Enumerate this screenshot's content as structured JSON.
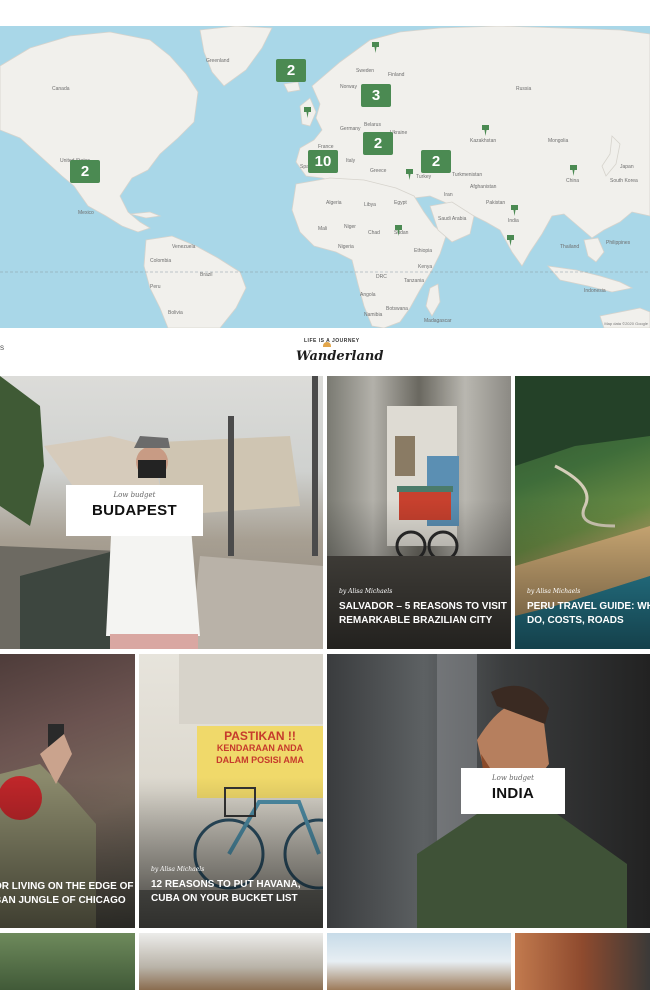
{
  "map": {
    "clusters": [
      {
        "name": "north-america",
        "count": "2"
      },
      {
        "name": "greenland-iceland",
        "count": "2"
      },
      {
        "name": "scandinavia",
        "count": "3"
      },
      {
        "name": "western-europe",
        "count": "10"
      },
      {
        "name": "balkans",
        "count": "2"
      },
      {
        "name": "middle-east",
        "count": "2"
      }
    ],
    "labels": {
      "greenland": "Greenland",
      "canada": "Canada",
      "usa": "United States",
      "mexico": "Mexico",
      "venezuela": "Venezuela",
      "colombia": "Colombia",
      "peru": "Peru",
      "brazil": "Brazil",
      "bolivia": "Bolivia",
      "sweden": "Sweden",
      "norway": "Norway",
      "finland": "Finland",
      "poland": "Poland",
      "ukraine": "Ukraine",
      "germany": "Germany",
      "france": "France",
      "spain": "Spain",
      "italy": "Italy",
      "greece": "Greece",
      "russia": "Russia",
      "kazakhstan": "Kazakhstan",
      "mongolia": "Mongolia",
      "china": "China",
      "turkey": "Turkey",
      "iran": "Iran",
      "afghanistan": "Afghanistan",
      "pakistan": "Pakistan",
      "india": "India",
      "saudi": "Saudi Arabia",
      "egypt": "Egypt",
      "libya": "Libya",
      "algeria": "Algeria",
      "mali": "Mali",
      "niger": "Niger",
      "chad": "Chad",
      "sudan": "Sudan",
      "ethiopia": "Ethiopia",
      "nigeria": "Nigeria",
      "drc": "DRC",
      "angola": "Angola",
      "tanzania": "Tanzania",
      "kenya": "Kenya",
      "namibia": "Namibia",
      "botswana": "Botswana",
      "madagascar": "Madagascar",
      "south_korea": "South Korea",
      "japan": "Japan",
      "thailand": "Thailand",
      "philippines": "Philippines",
      "indonesia": "Indonesia",
      "turkmenistan": "Turkmenistan",
      "belarus": "Belarus"
    },
    "credit": "Map data ©2020 Google"
  },
  "header": {
    "left_text": "S",
    "logo_top": "LIFE IS A JOURNEY",
    "logo_main": "Wanderland"
  },
  "posts": [
    {
      "id": "budapest",
      "category": "Low budget",
      "destination": "BUDAPEST"
    },
    {
      "id": "salvador",
      "byline": "by Alisa Michaels",
      "title_line1": "SALVADOR – 5 REASONS TO VISIT",
      "title_line2": "REMARKABLE BRAZILIAN CITY"
    },
    {
      "id": "peru",
      "byline": "by Alisa Michaels",
      "title_line1": "PERU TRAVEL GUIDE: WHAT",
      "title_line2": "DO, COSTS, ROADS"
    },
    {
      "id": "chicago",
      "title_line1": "OR LIVING ON THE EDGE OF",
      "title_line2": "BAN JUNGLE OF CHICAGO"
    },
    {
      "id": "havana",
      "byline": "by Alisa Michaels",
      "title_line1": "12 REASONS TO PUT HAVANA,",
      "title_line2": "CUBA ON YOUR BUCKET LIST",
      "sign_line1": "PASTIKAN !!",
      "sign_line2": "KENDARAAN ANDA",
      "sign_line3": "DALAM POSISI AMA"
    },
    {
      "id": "india",
      "category": "Low budget",
      "destination": "INDIA"
    }
  ],
  "colors": {
    "accent": "#4b8a52",
    "sea": "#a9d7e8",
    "land": "#f1f0ec"
  }
}
